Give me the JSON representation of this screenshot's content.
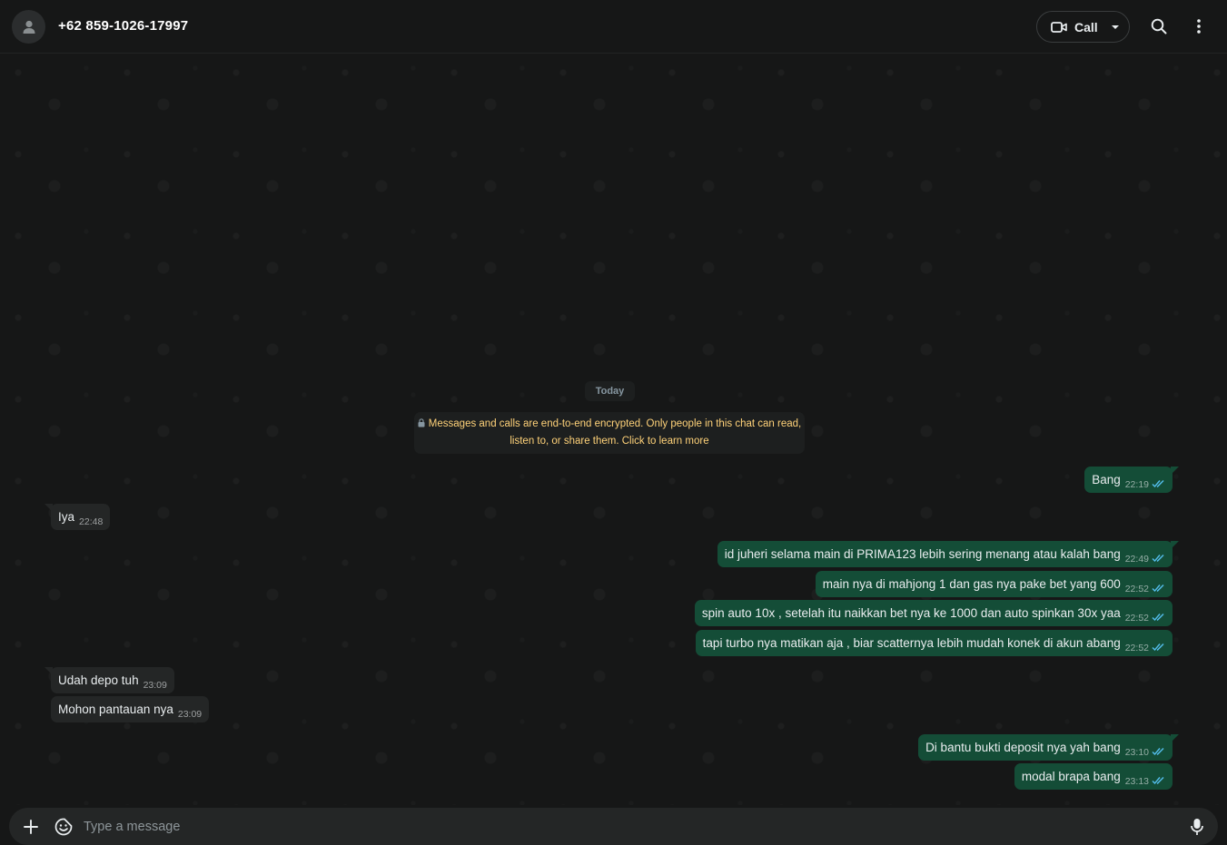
{
  "header": {
    "contact_name": "+62 859-1026-17997",
    "call_label": "Call"
  },
  "chat": {
    "date_label": "Today",
    "encryption_notice_line1": "Messages and calls are end-to-end encrypted. Only people in this chat can read,",
    "encryption_notice_line2": "listen to, or share them. Click to learn more",
    "messages": [
      {
        "dir": "out",
        "text": "Bang",
        "time": "22:19"
      },
      {
        "dir": "in",
        "text": "Iya",
        "time": "22:48"
      },
      {
        "dir": "out",
        "text": "id juheri selama main di PRIMA123 lebih sering menang atau kalah bang",
        "time": "22:49"
      },
      {
        "dir": "out",
        "text": "main nya di mahjong 1 dan gas nya pake bet yang 600",
        "time": "22:52"
      },
      {
        "dir": "out",
        "text": "spin auto 10x , setelah itu naikkan bet nya ke 1000 dan auto spinkan 30x yaa",
        "time": "22:52"
      },
      {
        "dir": "out",
        "text": "tapi turbo nya matikan aja , biar scatternya lebih mudah konek di akun abang",
        "time": "22:52"
      },
      {
        "dir": "in",
        "text": "Udah depo tuh",
        "time": "23:09"
      },
      {
        "dir": "in",
        "text": "Mohon pantauan nya",
        "time": "23:09"
      },
      {
        "dir": "out",
        "text": "Di bantu bukti deposit nya yah bang",
        "time": "23:10"
      },
      {
        "dir": "out",
        "text": "modal brapa bang",
        "time": "23:13"
      }
    ]
  },
  "composer": {
    "placeholder": "Type a message"
  },
  "colors": {
    "outgoing_bubble": "#144d37",
    "incoming_bubble": "#242626",
    "read_ticks": "#53bdeb",
    "notice_text": "#ffd279"
  }
}
